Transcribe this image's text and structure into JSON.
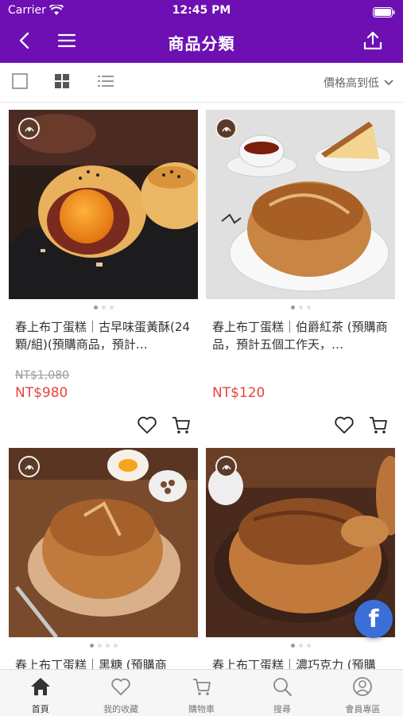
{
  "status": {
    "carrier": "Carrier",
    "time": "12:45 PM"
  },
  "nav": {
    "title": "商品分類"
  },
  "toolbar": {
    "sort_label": "價格高到低"
  },
  "products": [
    {
      "name": "春上布丁蛋糕｜古早味蛋黃酥(24顆/組)(預購商品，預計…",
      "old_price": "NT$1,080",
      "price": "NT$980"
    },
    {
      "name": "春上布丁蛋糕｜伯爵紅茶 (預購商品，預計五個工作天，…",
      "old_price": "",
      "price": "NT$120"
    },
    {
      "name": "春上布丁蛋糕｜黑糖 (預購商",
      "old_price": "",
      "price": ""
    },
    {
      "name": "春上布丁蛋糕｜濃巧克力 (預購",
      "old_price": "",
      "price": ""
    }
  ],
  "fab": {
    "label": "f"
  },
  "tabs": [
    {
      "label": "首頁",
      "icon": "home-icon",
      "active": true
    },
    {
      "label": "我的收藏",
      "icon": "heart-icon",
      "active": false
    },
    {
      "label": "購物車",
      "icon": "cart-icon",
      "active": false
    },
    {
      "label": "搜尋",
      "icon": "search-icon",
      "active": false
    },
    {
      "label": "會員專區",
      "icon": "user-icon",
      "active": false
    }
  ],
  "colors": {
    "brand": "#6d0fb3",
    "price": "#e8433f",
    "fb": "#3b6fd8"
  }
}
